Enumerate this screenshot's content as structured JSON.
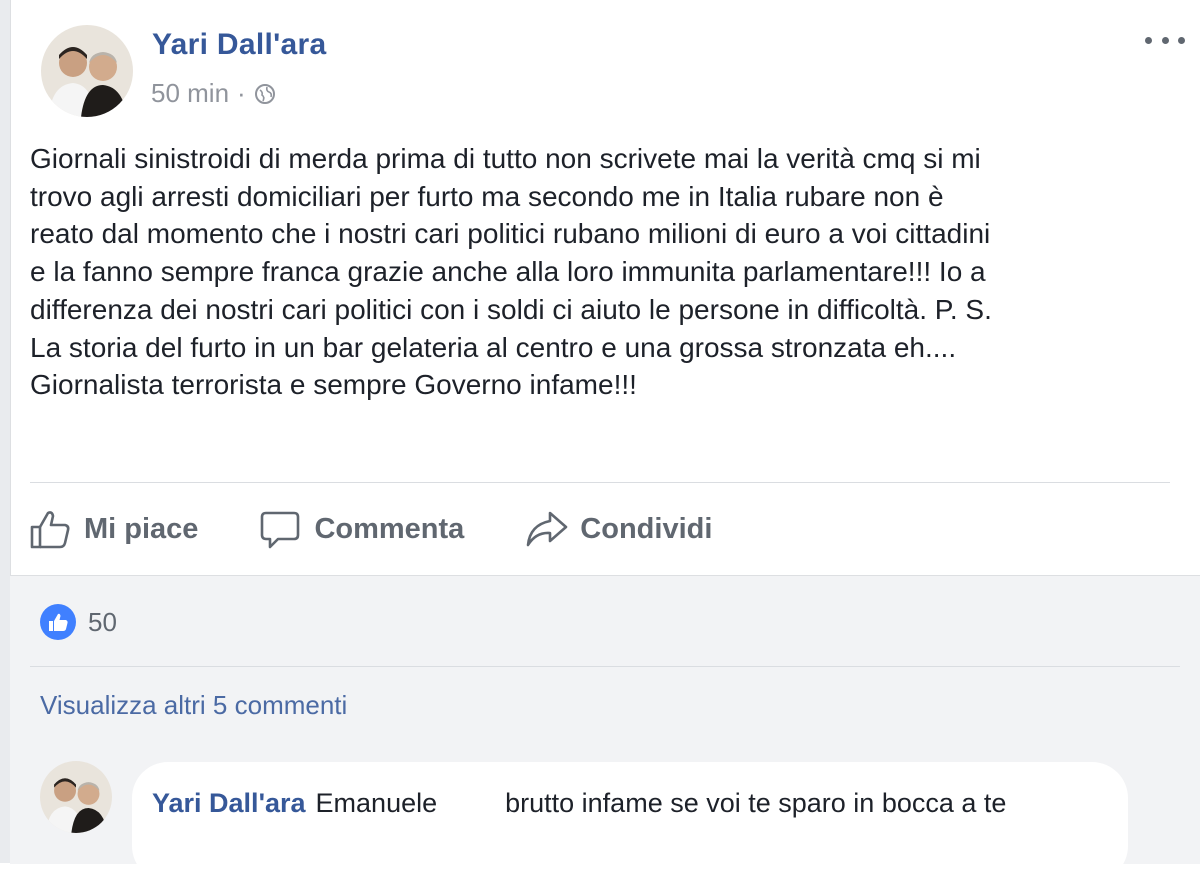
{
  "post": {
    "author": "Yari Dall'ara",
    "time": "50 min",
    "separator": "·",
    "privacy_icon": "globe-icon",
    "more_icon": "more-options-icon",
    "text": "Giornali sinistroidi di merda prima di tutto non scrivete mai la verità cmq si mi\ntrovo agli arresti domiciliari per furto ma secondo me in Italia rubare non è\nreato dal momento che i nostri cari politici rubano milioni di euro a voi cittadini\ne la fanno sempre franca grazie anche alla loro immunita parlamentare!!! Io a\ndifferenza dei nostri cari politici con i soldi ci aiuto le persone in difficoltà. P. S.\nLa storia del furto in un bar gelateria al centro e una grossa stronzata eh....\nGiornalista terrorista e sempre Governo infame!!!"
  },
  "actions": {
    "like": "Mi piace",
    "comment": "Commenta",
    "share": "Condividi"
  },
  "reactions": {
    "count": "50"
  },
  "comments": {
    "view_more": "Visualizza altri 5 commenti",
    "items": [
      {
        "author": "Yari Dall'ara",
        "tagged": "Emanuele",
        "text": "brutto infame se voi te sparo in bocca a te"
      }
    ]
  },
  "colors": {
    "link": "#365899",
    "muted": "#606770",
    "like_blue": "#4080ff",
    "feedback_bg": "#f2f3f5"
  }
}
